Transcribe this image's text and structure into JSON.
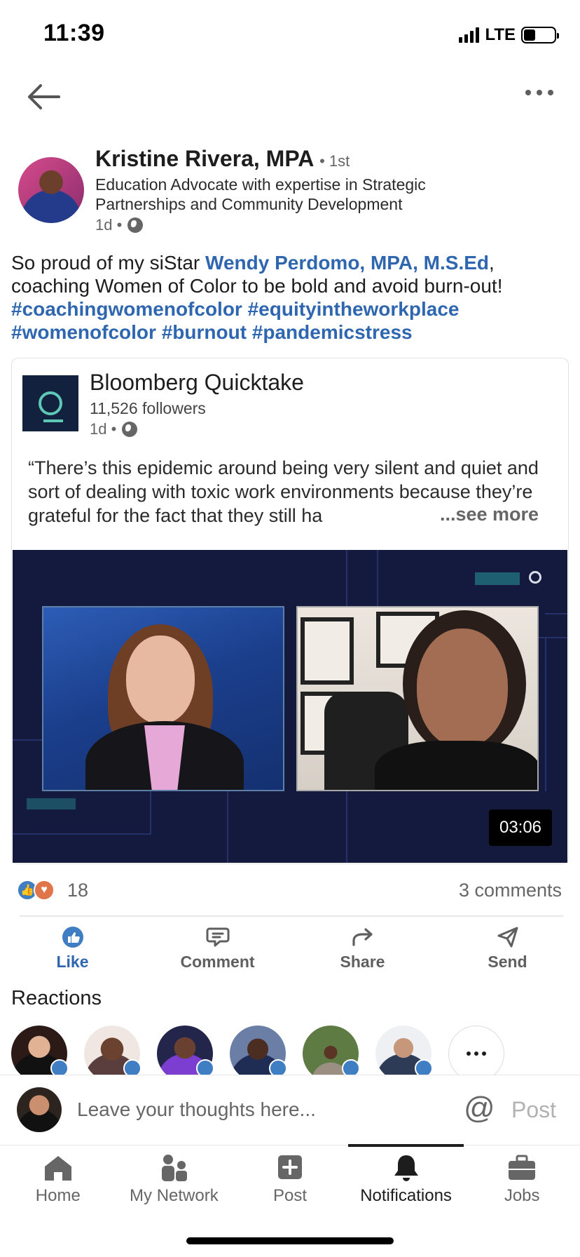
{
  "status_bar": {
    "time": "11:39",
    "network": "LTE"
  },
  "author": {
    "name": "Kristine Rivera, MPA",
    "degree": "• 1st",
    "headline": "Education Advocate with expertise in Strategic Partnerships and Community Development",
    "time": "1d •"
  },
  "post": {
    "text_before": "So proud of my siStar ",
    "mention": "Wendy Perdomo, MPA, M.S.Ed",
    "text_after": ", coaching Women of Color to be bold and avoid burn-out! ",
    "hashtags": [
      "#coachingwomenofcolor",
      "#equityintheworkplace",
      "#womenofcolor",
      "#burnout",
      "#pandemicstress"
    ]
  },
  "shared": {
    "source_name": "Bloomberg Quicktake",
    "followers": "11,526 followers",
    "time": "1d •",
    "quote": "“There’s this epidemic around being very silent and quiet and sort of dealing with toxic work environments because they’re grateful for the fact that they still ha",
    "see_more": "...see more",
    "video_duration": "03:06"
  },
  "social": {
    "reaction_count": "18",
    "comment_count": "3 comments"
  },
  "actions": [
    {
      "label": "Like",
      "icon": "like-icon"
    },
    {
      "label": "Comment",
      "icon": "comment-icon"
    },
    {
      "label": "Share",
      "icon": "share-icon"
    },
    {
      "label": "Send",
      "icon": "send-icon"
    }
  ],
  "reactions": {
    "title": "Reactions"
  },
  "comment_box": {
    "placeholder": "Leave your thoughts here...",
    "at_label": "@",
    "post_label": "Post"
  },
  "nav": [
    {
      "label": "Home",
      "icon": "home-icon"
    },
    {
      "label": "My Network",
      "icon": "network-icon"
    },
    {
      "label": "Post",
      "icon": "post-icon"
    },
    {
      "label": "Notifications",
      "icon": "bell-icon",
      "active": true
    },
    {
      "label": "Jobs",
      "icon": "briefcase-icon"
    }
  ],
  "colors": {
    "link": "#2f66b0",
    "like_blue": "#3f7ec3",
    "video_bg": "#141a3d"
  }
}
